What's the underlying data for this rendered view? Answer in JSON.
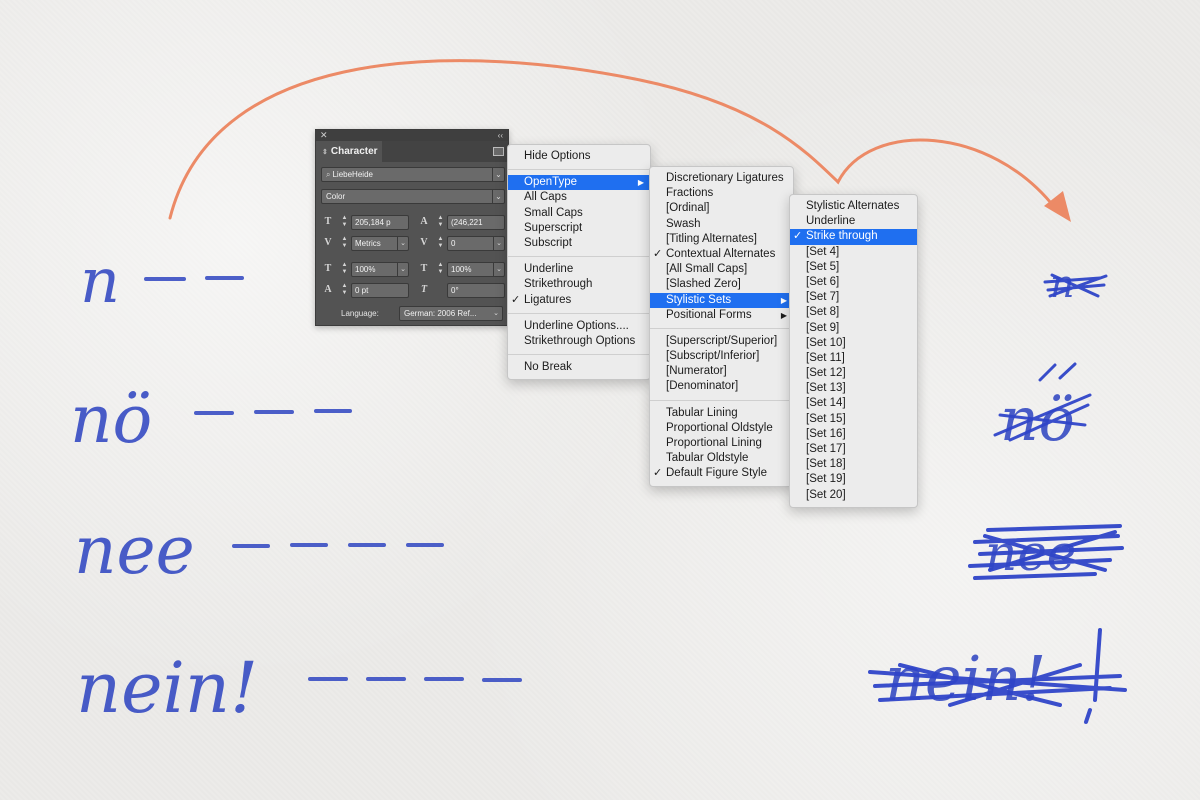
{
  "handwriting": {
    "left_words": [
      "n",
      "nö",
      "nee",
      "nein!"
    ],
    "right_glyphs": [
      "n",
      "nö",
      "nee",
      "nein!"
    ]
  },
  "colors": {
    "ink": "#3a4fc4",
    "arrow": "#ec8a66",
    "highlight": "#1f6ff0",
    "panel": "#535353"
  },
  "character_panel": {
    "close_icon": "close-icon",
    "collapse_icon": "double-chevron-icon",
    "tab_label": "Character",
    "font_family": "LiebeHeide",
    "font_style": "Color",
    "font_size": "205,184 p",
    "leading": "(246,221",
    "kerning": "Metrics",
    "tracking": "0",
    "vertical_scale": "100%",
    "horizontal_scale": "100%",
    "baseline_shift": "0 pt",
    "skew": "0°",
    "language_label": "Language:",
    "language_value": "German: 2006 Ref..."
  },
  "menu_main": {
    "items": [
      {
        "label": "Hide Options"
      },
      {
        "label": "OpenType",
        "highlight": true,
        "submenu": true
      },
      {
        "label": "All Caps"
      },
      {
        "label": "Small Caps"
      },
      {
        "label": "Superscript"
      },
      {
        "label": "Subscript"
      },
      {
        "label": "Underline"
      },
      {
        "label": "Strikethrough"
      },
      {
        "label": "Ligatures",
        "checked": true
      },
      {
        "label": "Underline Options...."
      },
      {
        "label": "Strikethrough Options"
      },
      {
        "label": "No Break"
      }
    ]
  },
  "menu_opentype": {
    "items": [
      {
        "label": "Discretionary Ligatures"
      },
      {
        "label": "Fractions"
      },
      {
        "label": "[Ordinal]"
      },
      {
        "label": "Swash"
      },
      {
        "label": "[Titling Alternates]"
      },
      {
        "label": "Contextual Alternates",
        "checked": true
      },
      {
        "label": "[All Small Caps]"
      },
      {
        "label": "[Slashed Zero]"
      },
      {
        "label": "Stylistic Sets",
        "highlight": true,
        "submenu": true
      },
      {
        "label": "Positional Forms",
        "submenu": true
      },
      {
        "label": "[Superscript/Superior]"
      },
      {
        "label": "[Subscript/Inferior]"
      },
      {
        "label": "[Numerator]"
      },
      {
        "label": "[Denominator]"
      },
      {
        "label": "Tabular Lining"
      },
      {
        "label": "Proportional Oldstyle"
      },
      {
        "label": "Proportional Lining"
      },
      {
        "label": "Tabular Oldstyle"
      },
      {
        "label": "Default Figure Style",
        "checked": true
      }
    ]
  },
  "menu_stylistic": {
    "items": [
      {
        "label": "Stylistic Alternates"
      },
      {
        "label": "Underline"
      },
      {
        "label": "Strike through",
        "checked": true,
        "highlight": true
      },
      {
        "label": "[Set 4]"
      },
      {
        "label": "[Set 5]"
      },
      {
        "label": "[Set 6]"
      },
      {
        "label": "[Set 7]"
      },
      {
        "label": "[Set 8]"
      },
      {
        "label": "[Set 9]"
      },
      {
        "label": "[Set 10]"
      },
      {
        "label": "[Set 11]"
      },
      {
        "label": "[Set 12]"
      },
      {
        "label": "[Set 13]"
      },
      {
        "label": "[Set 14]"
      },
      {
        "label": "[Set 15]"
      },
      {
        "label": "[Set 16]"
      },
      {
        "label": "[Set 17]"
      },
      {
        "label": "[Set 18]"
      },
      {
        "label": "[Set 19]"
      },
      {
        "label": "[Set 20]"
      }
    ]
  }
}
